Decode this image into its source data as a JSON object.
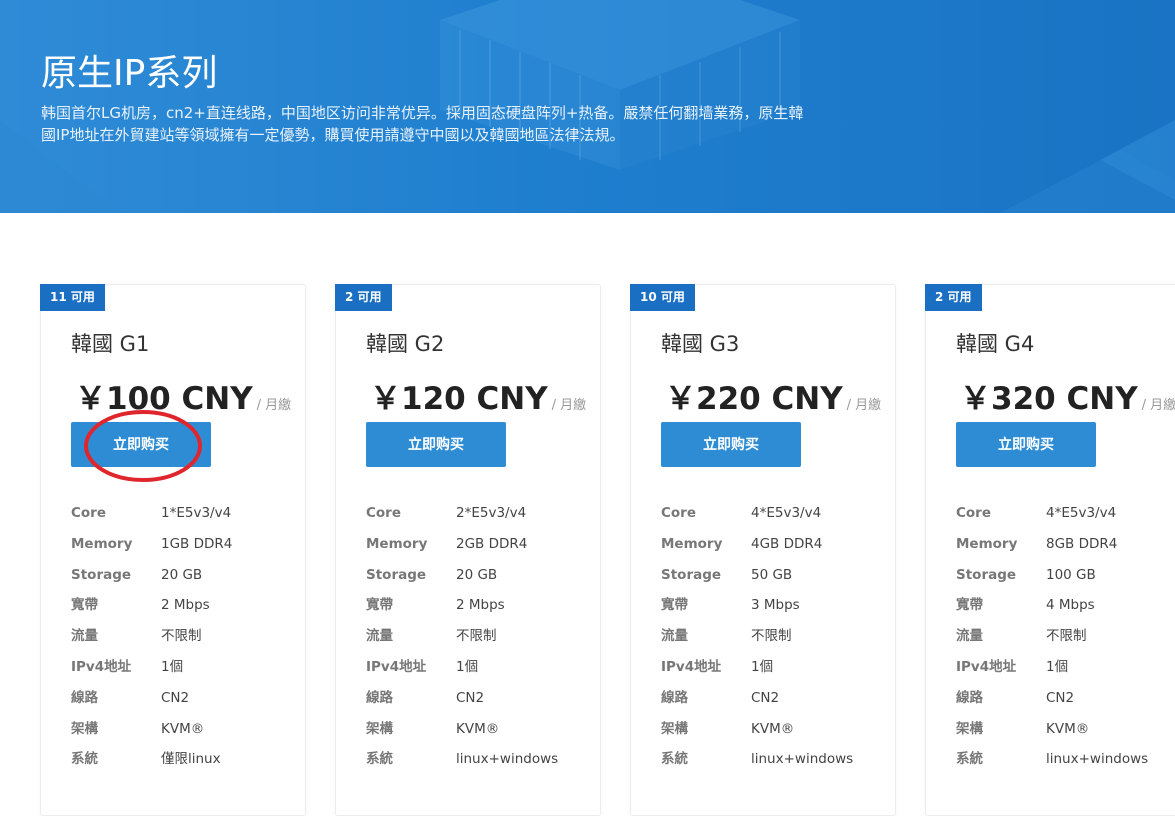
{
  "hero": {
    "title": "原生IP系列",
    "description": "韩国首尔LG机房，cn2+直连线路，中国地区访问非常优异。採用固态硬盘阵列+热备。嚴禁任何翻墙業務，原生韓國IP地址在外貿建站等領域擁有一定優勢，購買使用請遵守中國以及韓國地區法律法規。"
  },
  "colors": {
    "hero_bg": "#1f7fcf",
    "badge_bg": "#1a6fc2",
    "button_bg": "#2d8cd4",
    "annotation": "#e0262d"
  },
  "plans": [
    {
      "badge": "11 可用",
      "name": "韓國 G1",
      "price": "￥100 CNY",
      "period": "/ 月繳",
      "buy_label": "立即购买",
      "specs": [
        {
          "key": "Core",
          "value": "1*E5v3/v4"
        },
        {
          "key": "Memory",
          "value": "1GB DDR4"
        },
        {
          "key": "Storage",
          "value": "20 GB"
        },
        {
          "key": "寬帶",
          "value": "2 Mbps"
        },
        {
          "key": "流量",
          "value": "不限制"
        },
        {
          "key": "IPv4地址",
          "value": "1個"
        },
        {
          "key": "線路",
          "value": "CN2"
        },
        {
          "key": "架構",
          "value": "KVM®"
        },
        {
          "key": "系統",
          "value": "僅限linux"
        }
      ]
    },
    {
      "badge": "2 可用",
      "name": "韓國 G2",
      "price": "￥120 CNY",
      "period": "/ 月繳",
      "buy_label": "立即购买",
      "specs": [
        {
          "key": "Core",
          "value": "2*E5v3/v4"
        },
        {
          "key": "Memory",
          "value": "2GB DDR4"
        },
        {
          "key": "Storage",
          "value": "20 GB"
        },
        {
          "key": "寬帶",
          "value": "2 Mbps"
        },
        {
          "key": "流量",
          "value": "不限制"
        },
        {
          "key": "IPv4地址",
          "value": "1個"
        },
        {
          "key": "線路",
          "value": "CN2"
        },
        {
          "key": "架構",
          "value": "KVM®"
        },
        {
          "key": "系統",
          "value": "linux+windows"
        }
      ]
    },
    {
      "badge": "10 可用",
      "name": "韓國 G3",
      "price": "￥220 CNY",
      "period": "/ 月繳",
      "buy_label": "立即购买",
      "specs": [
        {
          "key": "Core",
          "value": "4*E5v3/v4"
        },
        {
          "key": "Memory",
          "value": "4GB DDR4"
        },
        {
          "key": "Storage",
          "value": "50 GB"
        },
        {
          "key": "寬帶",
          "value": "3 Mbps"
        },
        {
          "key": "流量",
          "value": "不限制"
        },
        {
          "key": "IPv4地址",
          "value": "1個"
        },
        {
          "key": "線路",
          "value": "CN2"
        },
        {
          "key": "架構",
          "value": "KVM®"
        },
        {
          "key": "系統",
          "value": "linux+windows"
        }
      ]
    },
    {
      "badge": "2 可用",
      "name": "韓國 G4",
      "price": "￥320 CNY",
      "period": "/ 月繳",
      "buy_label": "立即购买",
      "specs": [
        {
          "key": "Core",
          "value": "4*E5v3/v4"
        },
        {
          "key": "Memory",
          "value": "8GB DDR4"
        },
        {
          "key": "Storage",
          "value": "100 GB"
        },
        {
          "key": "寬帶",
          "value": "4 Mbps"
        },
        {
          "key": "流量",
          "value": "不限制"
        },
        {
          "key": "IPv4地址",
          "value": "1個"
        },
        {
          "key": "線路",
          "value": "CN2"
        },
        {
          "key": "架構",
          "value": "KVM®"
        },
        {
          "key": "系統",
          "value": "linux+windows"
        }
      ]
    }
  ]
}
